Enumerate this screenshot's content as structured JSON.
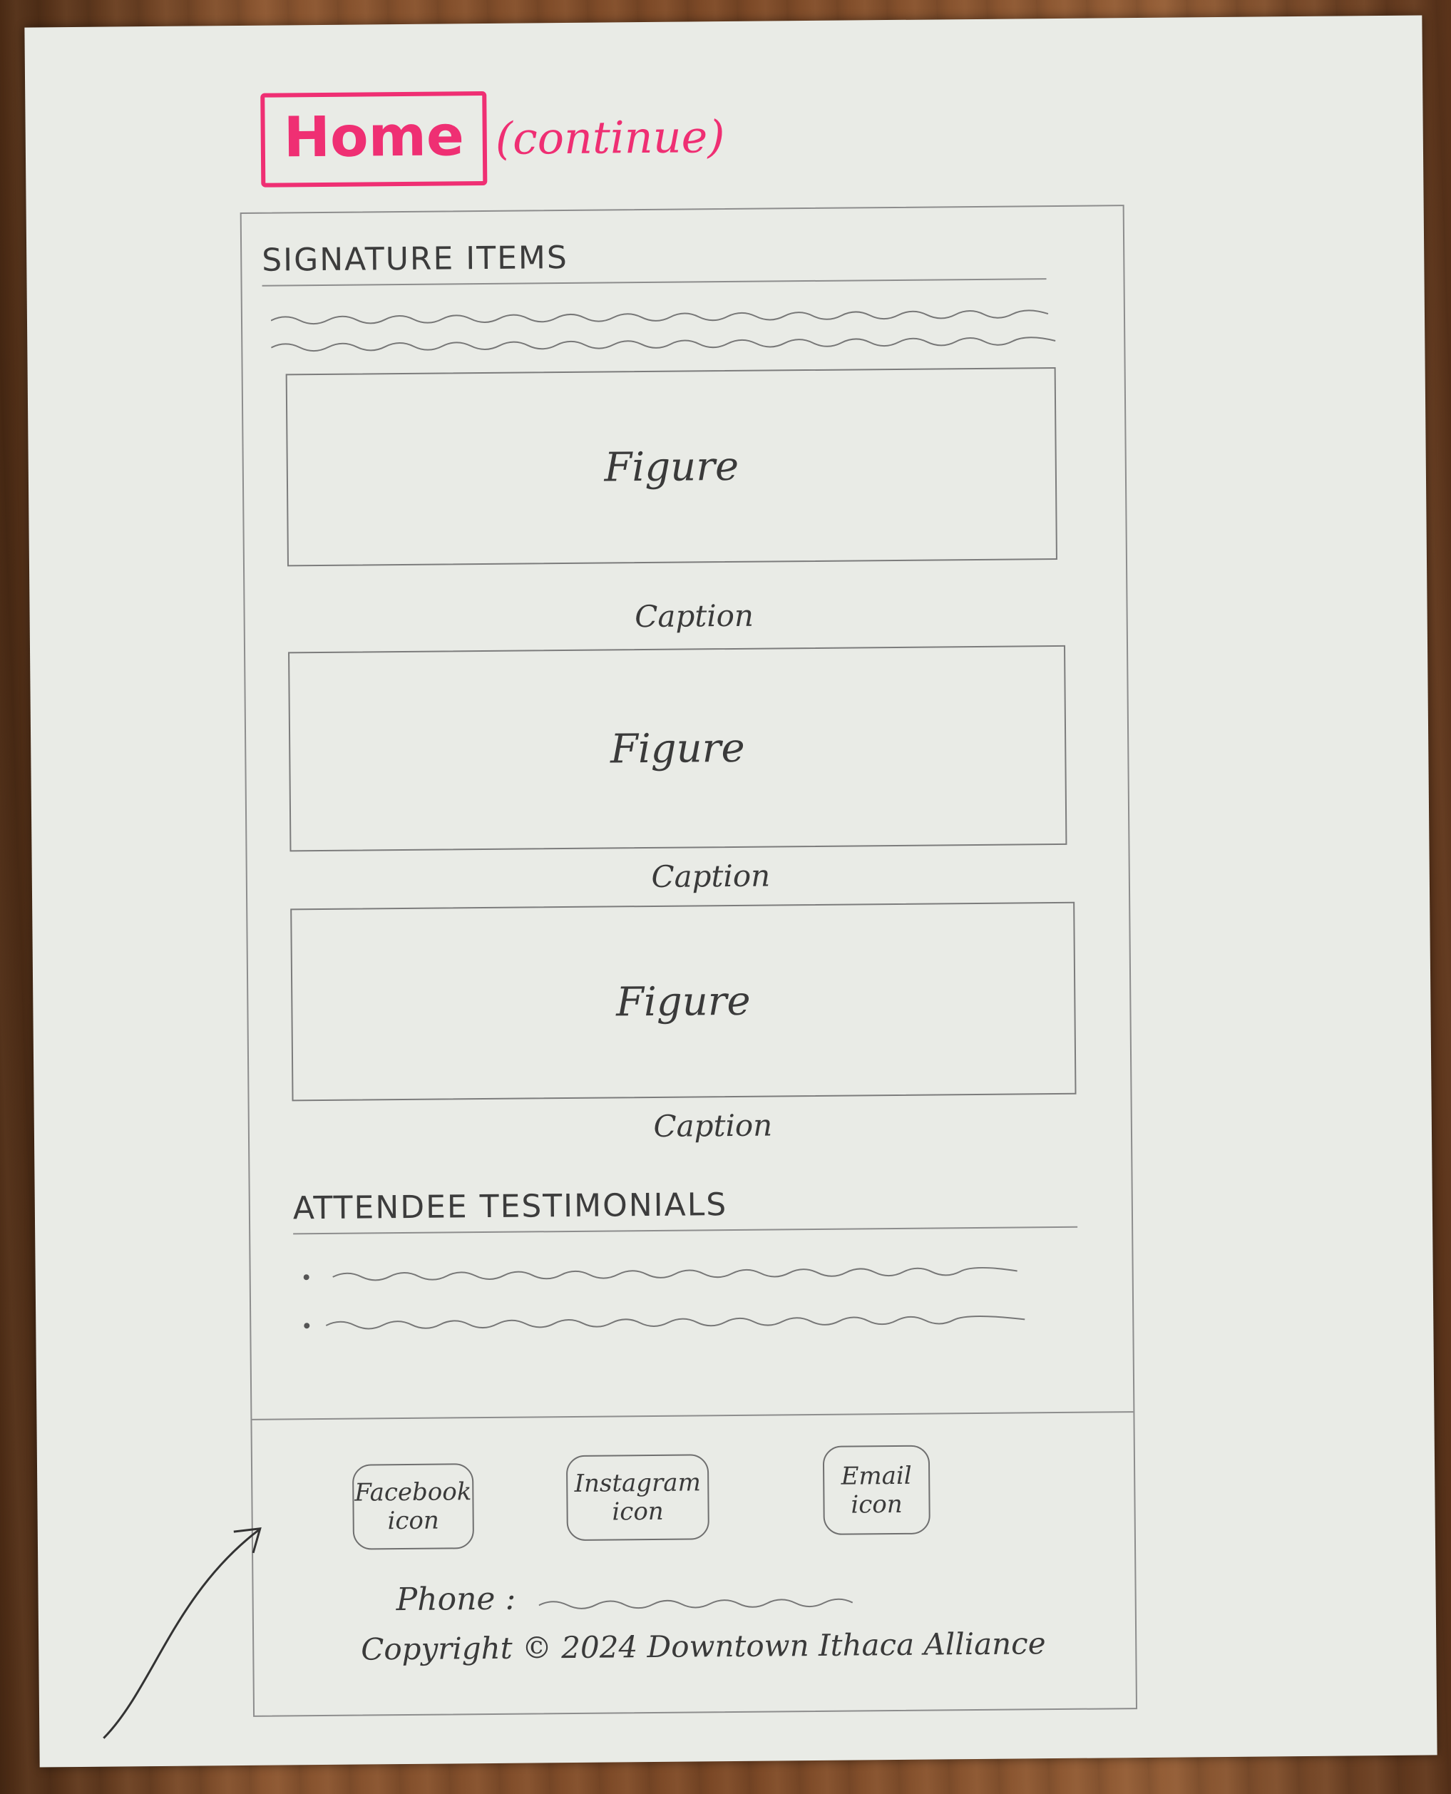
{
  "header": {
    "title": "Home",
    "subtitle": "(continue)"
  },
  "signature": {
    "heading": "SIGNATURE ITEMS",
    "figures": [
      {
        "label": "Figure",
        "caption": "Caption"
      },
      {
        "label": "Figure",
        "caption": "Caption"
      },
      {
        "label": "Figure",
        "caption": "Caption"
      }
    ]
  },
  "testimonials": {
    "heading": "ATTENDEE TESTIMONIALS"
  },
  "footer": {
    "facebook_line1": "Facebook",
    "facebook_line2": "icon",
    "instagram_line1": "Instagram",
    "instagram_line2": "icon",
    "email_line1": "Email",
    "email_line2": "icon",
    "phone_label": "Phone :",
    "copyright": "Copyright © 2024 Downtown Ithaca Alliance"
  },
  "colors": {
    "accent": "#ef2f73",
    "pencil": "#3a3a3a"
  }
}
